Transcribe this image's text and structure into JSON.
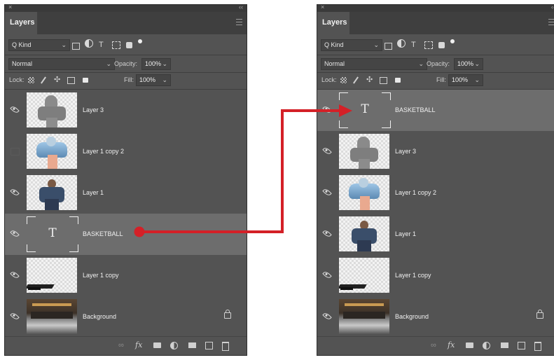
{
  "panels": {
    "left": {
      "close_glyph": "×",
      "collapse_glyph": "‹‹",
      "tab_label": "Layers",
      "filter_kind": "Kind",
      "blend_mode": "Normal",
      "opacity_label": "Opacity:",
      "opacity_value": "100%",
      "lock_label": "Lock:",
      "fill_label": "Fill:",
      "fill_value": "100%",
      "layers": [
        {
          "name": "Layer 3",
          "visible": true
        },
        {
          "name": "Layer 1 copy 2",
          "visible": false
        },
        {
          "name": "Layer 1",
          "visible": true
        },
        {
          "name": "BASKETBALL",
          "visible": true,
          "type": "text",
          "selected": true
        },
        {
          "name": "Layer 1 copy",
          "visible": true
        },
        {
          "name": "Background",
          "visible": true,
          "locked": true
        }
      ]
    },
    "right": {
      "close_glyph": "×",
      "collapse_glyph": "‹‹",
      "tab_label": "Layers",
      "filter_kind": "Kind",
      "blend_mode": "Normal",
      "opacity_label": "Opacity:",
      "opacity_value": "100%",
      "lock_label": "Lock:",
      "fill_label": "Fill:",
      "fill_value": "100%",
      "layers": [
        {
          "name": "BASKETBALL",
          "visible": true,
          "type": "text",
          "selected": true
        },
        {
          "name": "Layer 3",
          "visible": true
        },
        {
          "name": "Layer 1 copy 2",
          "visible": true
        },
        {
          "name": "Layer 1",
          "visible": true
        },
        {
          "name": "Layer 1 copy",
          "visible": true
        },
        {
          "name": "Background",
          "visible": true,
          "locked": true
        }
      ]
    }
  },
  "glyphs": {
    "search": "Q",
    "dropdown": "⌄",
    "type_filter": "T",
    "text_thumb": "T",
    "fx": "fx"
  },
  "colors": {
    "panel_bg": "#535353",
    "selected_row": "#6d6d6d",
    "annotation_arrow": "#d42027"
  }
}
